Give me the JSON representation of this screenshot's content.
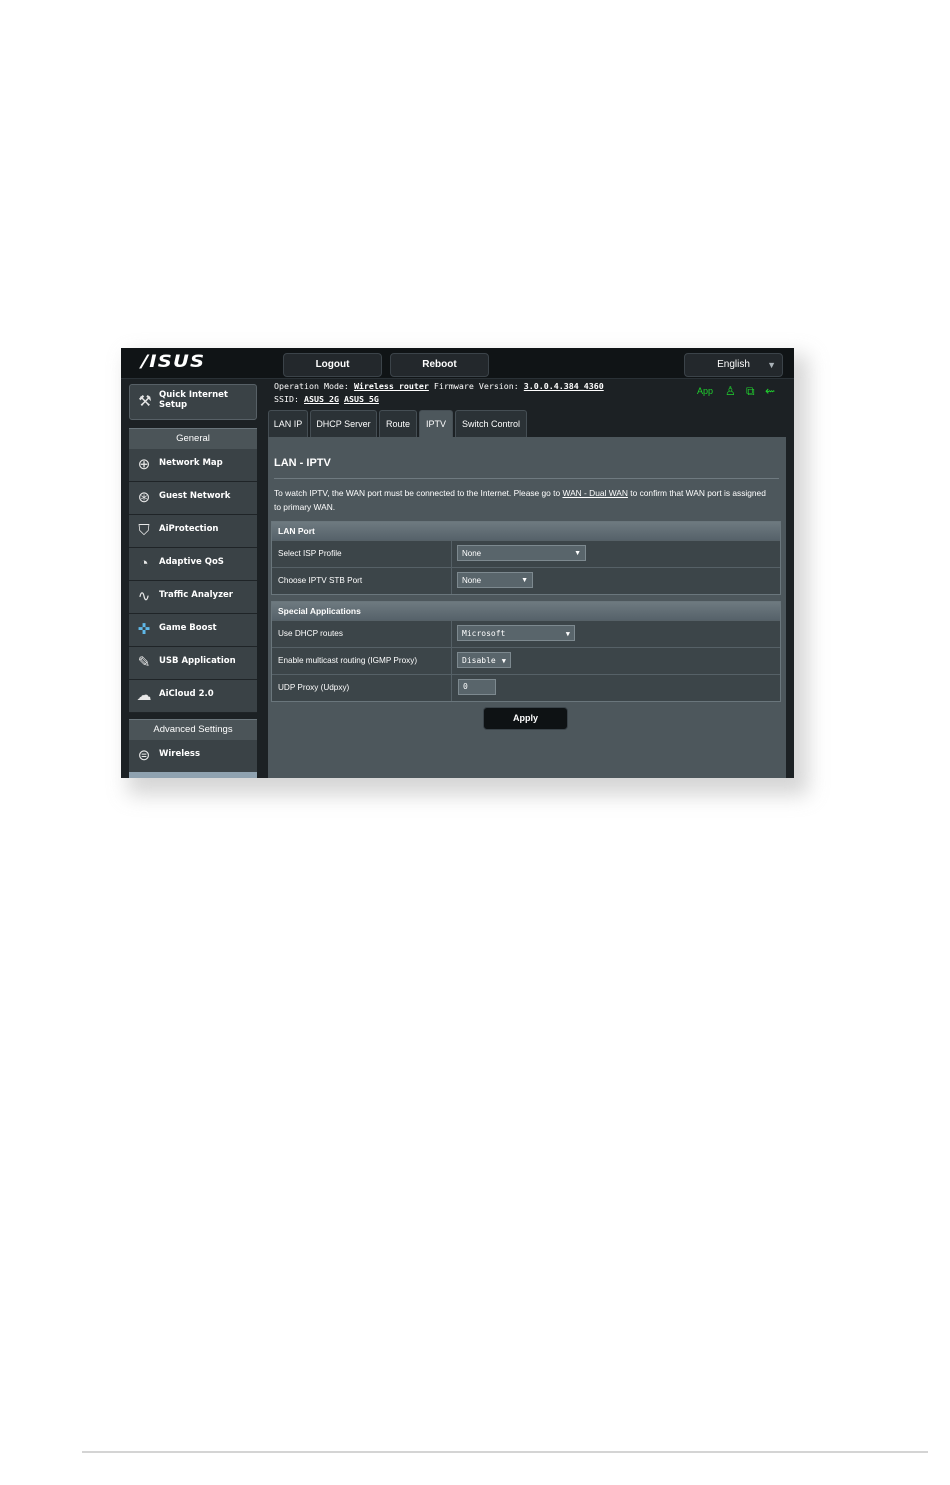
{
  "header": {
    "logo": "/ISUS",
    "logout_label": "Logout",
    "reboot_label": "Reboot",
    "language": "English"
  },
  "info": {
    "operation_mode_label": "Operation Mode:",
    "operation_mode_value": "Wireless router",
    "firmware_label": "Firmware Version:",
    "firmware_value": "3.0.0.4.384_4360",
    "ssid_label": "SSID:",
    "ssid_2g": "ASUS_2G",
    "ssid_5g": "ASUS_5G",
    "app_label": "App"
  },
  "sidebar": {
    "quick_setup": "Quick Internet Setup",
    "general_heading": "General",
    "general_items": [
      {
        "label": "Network Map",
        "icon": "network-map-icon"
      },
      {
        "label": "Guest Network",
        "icon": "guest-network-icon"
      },
      {
        "label": "AiProtection",
        "icon": "aiprotection-icon"
      },
      {
        "label": "Adaptive QoS",
        "icon": "adaptive-qos-icon"
      },
      {
        "label": "Traffic Analyzer",
        "icon": "traffic-analyzer-icon"
      },
      {
        "label": "Game Boost",
        "icon": "game-boost-icon"
      },
      {
        "label": "USB Application",
        "icon": "usb-application-icon"
      },
      {
        "label": "AiCloud 2.0",
        "icon": "aicloud-icon"
      }
    ],
    "advanced_heading": "Advanced Settings",
    "advanced_items": [
      {
        "label": "Wireless",
        "icon": "wireless-icon"
      }
    ]
  },
  "tabs": [
    {
      "label": "LAN IP"
    },
    {
      "label": "DHCP Server"
    },
    {
      "label": "Route"
    },
    {
      "label": "IPTV",
      "active": true
    },
    {
      "label": "Switch Control"
    }
  ],
  "panel": {
    "title": "LAN - IPTV",
    "description_before": "To watch IPTV, the WAN port must be connected to the Internet. Please go to ",
    "description_link": "WAN - Dual WAN",
    "description_after": " to confirm that WAN port is assigned to primary WAN.",
    "lan_port": {
      "heading": "LAN Port",
      "isp_profile_label": "Select ISP Profile",
      "isp_profile_value": "None",
      "stb_port_label": "Choose IPTV STB Port",
      "stb_port_value": "None"
    },
    "special": {
      "heading": "Special Applications",
      "dhcp_routes_label": "Use DHCP routes",
      "dhcp_routes_value": "Microsoft",
      "multicast_label": "Enable multicast routing (IGMP Proxy)",
      "multicast_value": "Disable",
      "udpxy_label": "UDP Proxy (Udpxy)",
      "udpxy_value": "0"
    },
    "apply_label": "Apply"
  },
  "colors": {
    "status_green": "#1fd12e",
    "panel_bg": "#4d575c",
    "sidebar_item_bg": "#3a4246"
  }
}
